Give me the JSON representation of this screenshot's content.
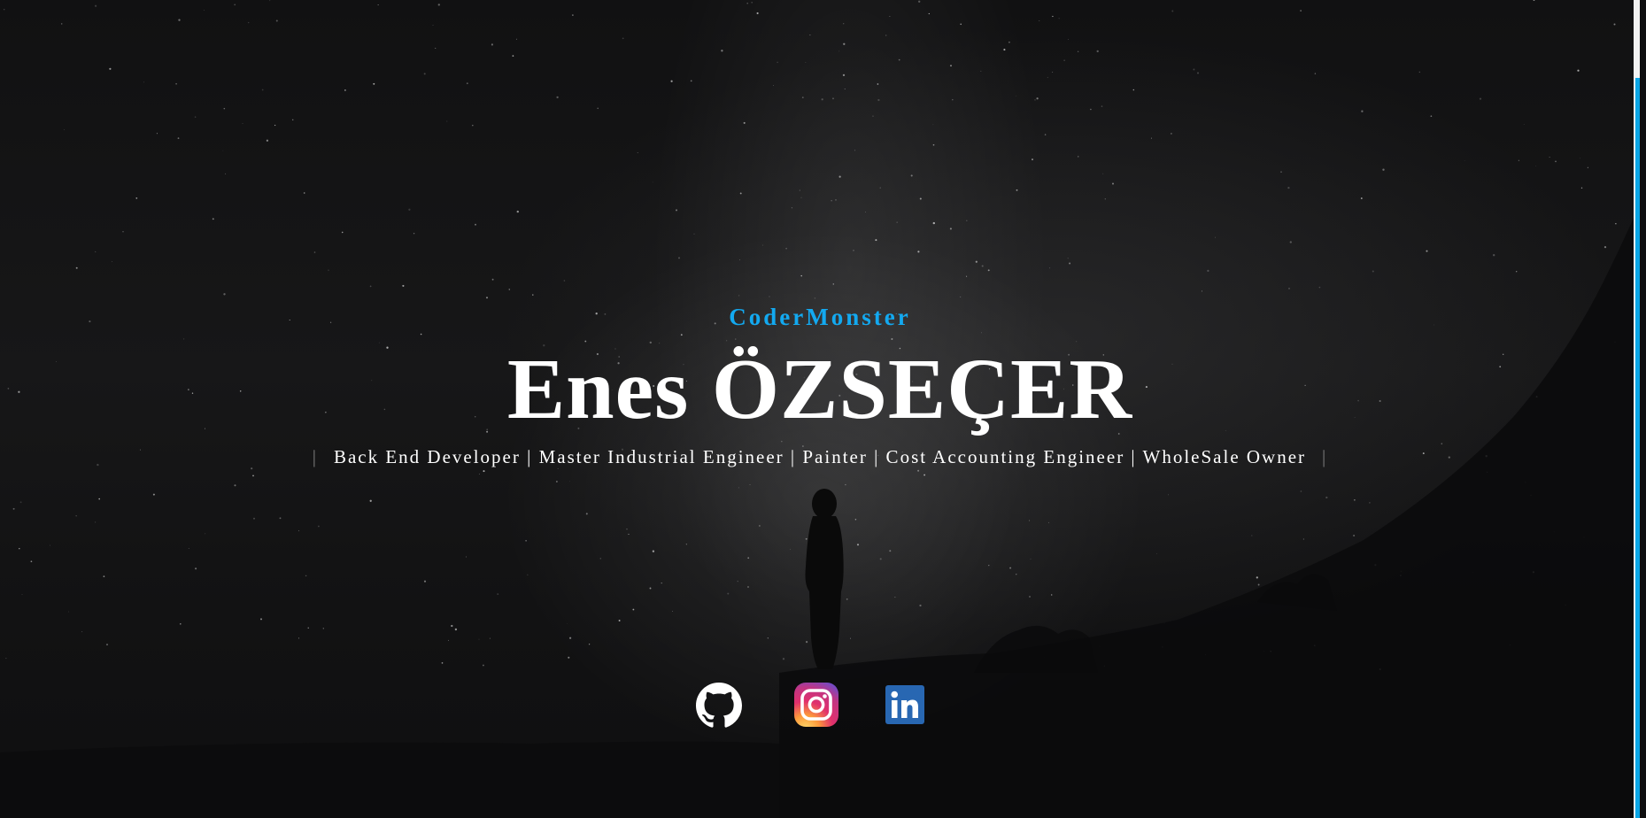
{
  "brand": "CoderMonster",
  "name": "Enes ÖZSEÇER",
  "roles": {
    "separator_left": "|",
    "text": "Back End Developer | Master Industrial Engineer | Painter | Cost Accounting Engineer | WholeSale Owner",
    "separator_right": "|"
  },
  "socials": [
    {
      "icon": "github-icon",
      "color": "#ffffff"
    },
    {
      "icon": "instagram-icon",
      "color": "#e1306c"
    },
    {
      "icon": "linkedin-icon",
      "color": "#2867b2"
    }
  ],
  "colors": {
    "accent": "#13a9f0",
    "background": "#0e0e0f",
    "text": "#ffffff"
  }
}
